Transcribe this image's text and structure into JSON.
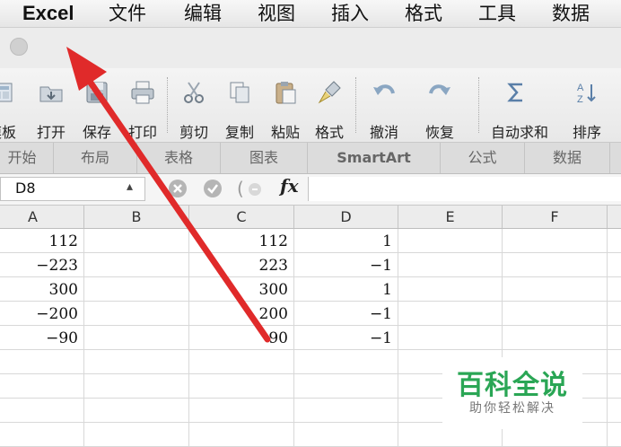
{
  "menu_bar": {
    "app_name": "Excel",
    "items": [
      "文件",
      "编辑",
      "视图",
      "插入",
      "格式",
      "工具",
      "数据"
    ]
  },
  "toolbar": {
    "buttons": [
      {
        "label": "模板",
        "icon": "template-icon"
      },
      {
        "label": "打开",
        "icon": "open-folder-icon"
      },
      {
        "label": "保存",
        "icon": "save-disk-icon"
      },
      {
        "label": "打印",
        "icon": "printer-icon"
      },
      {
        "label": "剪切",
        "icon": "scissors-icon"
      },
      {
        "label": "复制",
        "icon": "copy-icon"
      },
      {
        "label": "粘贴",
        "icon": "paste-icon"
      },
      {
        "label": "格式",
        "icon": "format-brush-icon"
      },
      {
        "label": "撤消",
        "icon": "undo-icon"
      },
      {
        "label": "恢复",
        "icon": "redo-icon"
      },
      {
        "label": "自动求和",
        "icon": "sum-icon"
      },
      {
        "label": "排序",
        "icon": "sort-icon"
      }
    ]
  },
  "ribbon_tabs": [
    "开始",
    "布局",
    "表格",
    "图表",
    "SmartArt",
    "公式",
    "数据"
  ],
  "formula_bar": {
    "name_box": "D8",
    "fx_label": "fx",
    "formula": ""
  },
  "sheet": {
    "columns": [
      "A",
      "B",
      "C",
      "D",
      "E",
      "F"
    ],
    "rows": [
      [
        "112",
        "",
        "112",
        "1",
        "",
        ""
      ],
      [
        "−223",
        "",
        "223",
        "−1",
        "",
        ""
      ],
      [
        "300",
        "",
        "300",
        "1",
        "",
        ""
      ],
      [
        "−200",
        "",
        "200",
        "−1",
        "",
        ""
      ],
      [
        "−90",
        "",
        "90",
        "−1",
        "",
        ""
      ],
      [
        "",
        "",
        "",
        "",
        "",
        ""
      ],
      [
        "",
        "",
        "",
        "",
        "",
        ""
      ],
      [
        "",
        "",
        "",
        "",
        "",
        ""
      ],
      [
        "",
        "",
        "",
        "",
        "",
        ""
      ]
    ]
  },
  "watermark": {
    "title": "百科全说",
    "subtitle": "助你轻松解决"
  },
  "colors": {
    "annotation_arrow": "#e02a2a",
    "watermark_green": "#2aa655"
  }
}
